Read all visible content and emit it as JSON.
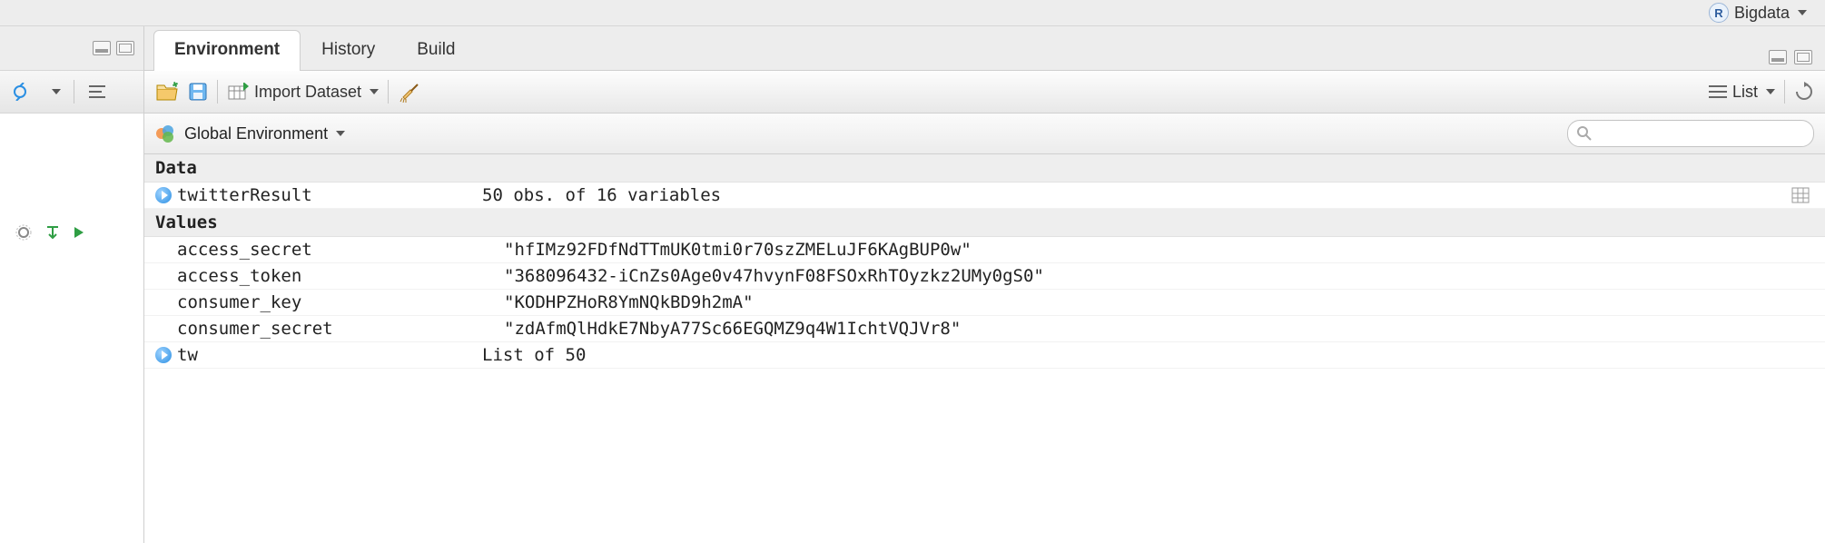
{
  "project": {
    "name": "Bigdata"
  },
  "tabs": [
    {
      "label": "Environment",
      "active": true
    },
    {
      "label": "History",
      "active": false
    },
    {
      "label": "Build",
      "active": false
    }
  ],
  "toolbar": {
    "import_label": "Import Dataset",
    "list_label": "List"
  },
  "scope": {
    "label": "Global Environment"
  },
  "search": {
    "placeholder": ""
  },
  "env": {
    "sections": [
      {
        "title": "Data",
        "rows": [
          {
            "name": "twitterResult",
            "value": "50 obs. of 16 variables",
            "expandable": true,
            "grid": true
          }
        ]
      },
      {
        "title": "Values",
        "rows": [
          {
            "name": "access_secret",
            "value": "\"hfIMz92FDfNdTTmUK0tmi0r70szZMELuJF6KAgBUP0w\""
          },
          {
            "name": "access_token",
            "value": "\"368096432-iCnZs0Age0v47hvynF08FSOxRhTOyzkz2UMy0gS0\""
          },
          {
            "name": "consumer_key",
            "value": "\"KODHPZHoR8YmNQkBD9h2mA\""
          },
          {
            "name": "consumer_secret",
            "value": "\"zdAfmQlHdkE7NbyA77Sc66EGQMZ9q4W1IchtVQJVr8\""
          },
          {
            "name": "tw",
            "value": "List of 50",
            "expandable": true
          }
        ]
      }
    ]
  }
}
